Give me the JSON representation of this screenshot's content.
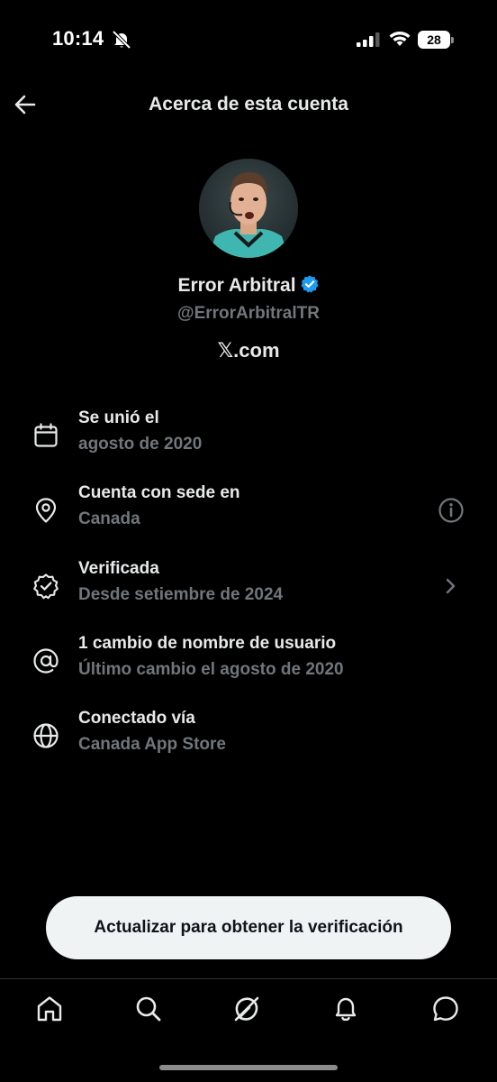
{
  "status_bar": {
    "time": "10:14",
    "battery": "28",
    "icons": [
      "bell-slash-icon",
      "signal-icon",
      "wifi-icon",
      "battery-icon"
    ]
  },
  "header": {
    "title": "Acerca de esta cuenta",
    "back_icon": "arrow-left-icon"
  },
  "profile": {
    "name": "Error Arbitral",
    "handle": "@ErrorArbitralTR",
    "site": "𝕏.com",
    "verified_color": "#1d9bf0"
  },
  "info": [
    {
      "icon": "calendar-icon",
      "title": "Se unió el",
      "subtitle": "agosto de 2020"
    },
    {
      "icon": "location-pin-icon",
      "title": "Cuenta con sede en",
      "subtitle": "Canada",
      "trailing": "info-icon"
    },
    {
      "icon": "verified-badge-icon",
      "title": "Verificada",
      "subtitle": "Desde setiembre de 2024",
      "trailing": "chevron-right-icon"
    },
    {
      "icon": "at-sign-icon",
      "title": "1 cambio de nombre de usuario",
      "subtitle": "Último cambio el agosto de 2020"
    },
    {
      "icon": "globe-icon",
      "title": "Conectado vía",
      "subtitle": "Canada App Store"
    }
  ],
  "cta": {
    "label": "Actualizar para obtener la verificación"
  },
  "tabbar": {
    "items": [
      "home-icon",
      "search-icon",
      "grok-icon",
      "notifications-icon",
      "messages-icon"
    ]
  },
  "colors": {
    "background": "#000000",
    "primary_text": "#e7e9ea",
    "secondary_text": "#71767b",
    "button_bg": "#eff3f4"
  }
}
